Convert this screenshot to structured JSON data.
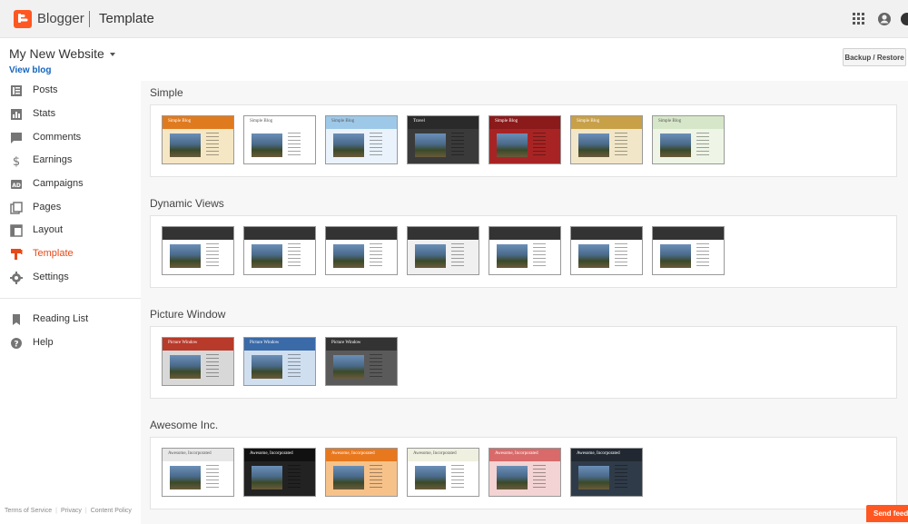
{
  "app": {
    "brand": "Blogger",
    "section": "Template"
  },
  "colors": {
    "accent": "#ff5722",
    "active_nav": "#e64a19",
    "link": "#1565c0"
  },
  "header": {
    "blog_name": "My New Website",
    "view_blog": "View blog",
    "backup_button": "Backup / Restore",
    "icons": [
      "apps-grid-icon",
      "account-circle-icon",
      "avatar"
    ]
  },
  "sidebar": {
    "items": [
      {
        "label": "Posts",
        "icon": "posts-icon"
      },
      {
        "label": "Stats",
        "icon": "stats-icon"
      },
      {
        "label": "Comments",
        "icon": "comments-icon"
      },
      {
        "label": "Earnings",
        "icon": "dollar-icon"
      },
      {
        "label": "Campaigns",
        "icon": "ad-icon"
      },
      {
        "label": "Pages",
        "icon": "pages-icon"
      },
      {
        "label": "Layout",
        "icon": "layout-icon"
      },
      {
        "label": "Template",
        "icon": "template-icon",
        "active": true
      },
      {
        "label": "Settings",
        "icon": "gear-icon"
      }
    ],
    "secondary": [
      {
        "label": "Reading List",
        "icon": "bookmark-icon"
      },
      {
        "label": "Help",
        "icon": "help-icon"
      }
    ]
  },
  "footer": {
    "links": [
      "Terms of Service",
      "Privacy",
      "Content Policy"
    ]
  },
  "feedback": {
    "label": "Send feedback"
  },
  "groups": [
    {
      "title": "Simple",
      "thumbs": [
        {
          "label": "Simple Blog",
          "band": "#e07a1f",
          "bg": "#f5e7c4"
        },
        {
          "label": "Simple Blog",
          "band": "#ffffff",
          "bg": "#ffffff"
        },
        {
          "label": "Simple Blog",
          "band": "#9ec8e8",
          "bg": "#eaf3fb"
        },
        {
          "label": "Travel",
          "band": "#2a2a2a",
          "bg": "#3a3a3a"
        },
        {
          "label": "Simple Blog",
          "band": "#8b1a1a",
          "bg": "#a82424"
        },
        {
          "label": "Simple Blog",
          "band": "#c8a048",
          "bg": "#f1e7c8"
        },
        {
          "label": "Simple Blog",
          "band": "#d6e6c8",
          "bg": "#eef5e6"
        }
      ]
    },
    {
      "title": "Dynamic Views",
      "thumbs": [
        {
          "label": "",
          "band": "#333333",
          "bg": "#ffffff"
        },
        {
          "label": "",
          "band": "#333333",
          "bg": "#ffffff"
        },
        {
          "label": "",
          "band": "#333333",
          "bg": "#ffffff"
        },
        {
          "label": "",
          "band": "#333333",
          "bg": "#f0f0f0"
        },
        {
          "label": "",
          "band": "#333333",
          "bg": "#ffffff"
        },
        {
          "label": "",
          "band": "#333333",
          "bg": "#ffffff"
        },
        {
          "label": "",
          "band": "#333333",
          "bg": "#ffffff"
        }
      ]
    },
    {
      "title": "Picture Window",
      "thumbs": [
        {
          "label": "Picture Window",
          "band": "#b83a2a",
          "bg": "#d8d8d8"
        },
        {
          "label": "Picture Window",
          "band": "#3a6aa8",
          "bg": "#cfdff0"
        },
        {
          "label": "Picture Window",
          "band": "#333333",
          "bg": "#5a5a5a"
        }
      ]
    },
    {
      "title": "Awesome Inc.",
      "thumbs": [
        {
          "label": "Awesome, Incorporated",
          "band": "#e8e8e8",
          "bg": "#ffffff"
        },
        {
          "label": "Awesome, Incorporated",
          "band": "#111111",
          "bg": "#222222"
        },
        {
          "label": "Awesome, Incorporated",
          "band": "#e8781e",
          "bg": "#f6c28a"
        },
        {
          "label": "Awesome, Incorporated",
          "band": "#f0f0e0",
          "bg": "#ffffff"
        },
        {
          "label": "Awesome, Incorporated",
          "band": "#d86a6a",
          "bg": "#f3d3d3"
        },
        {
          "label": "Awesome, Incorporated",
          "band": "#222831",
          "bg": "#2f3b48"
        }
      ]
    }
  ]
}
